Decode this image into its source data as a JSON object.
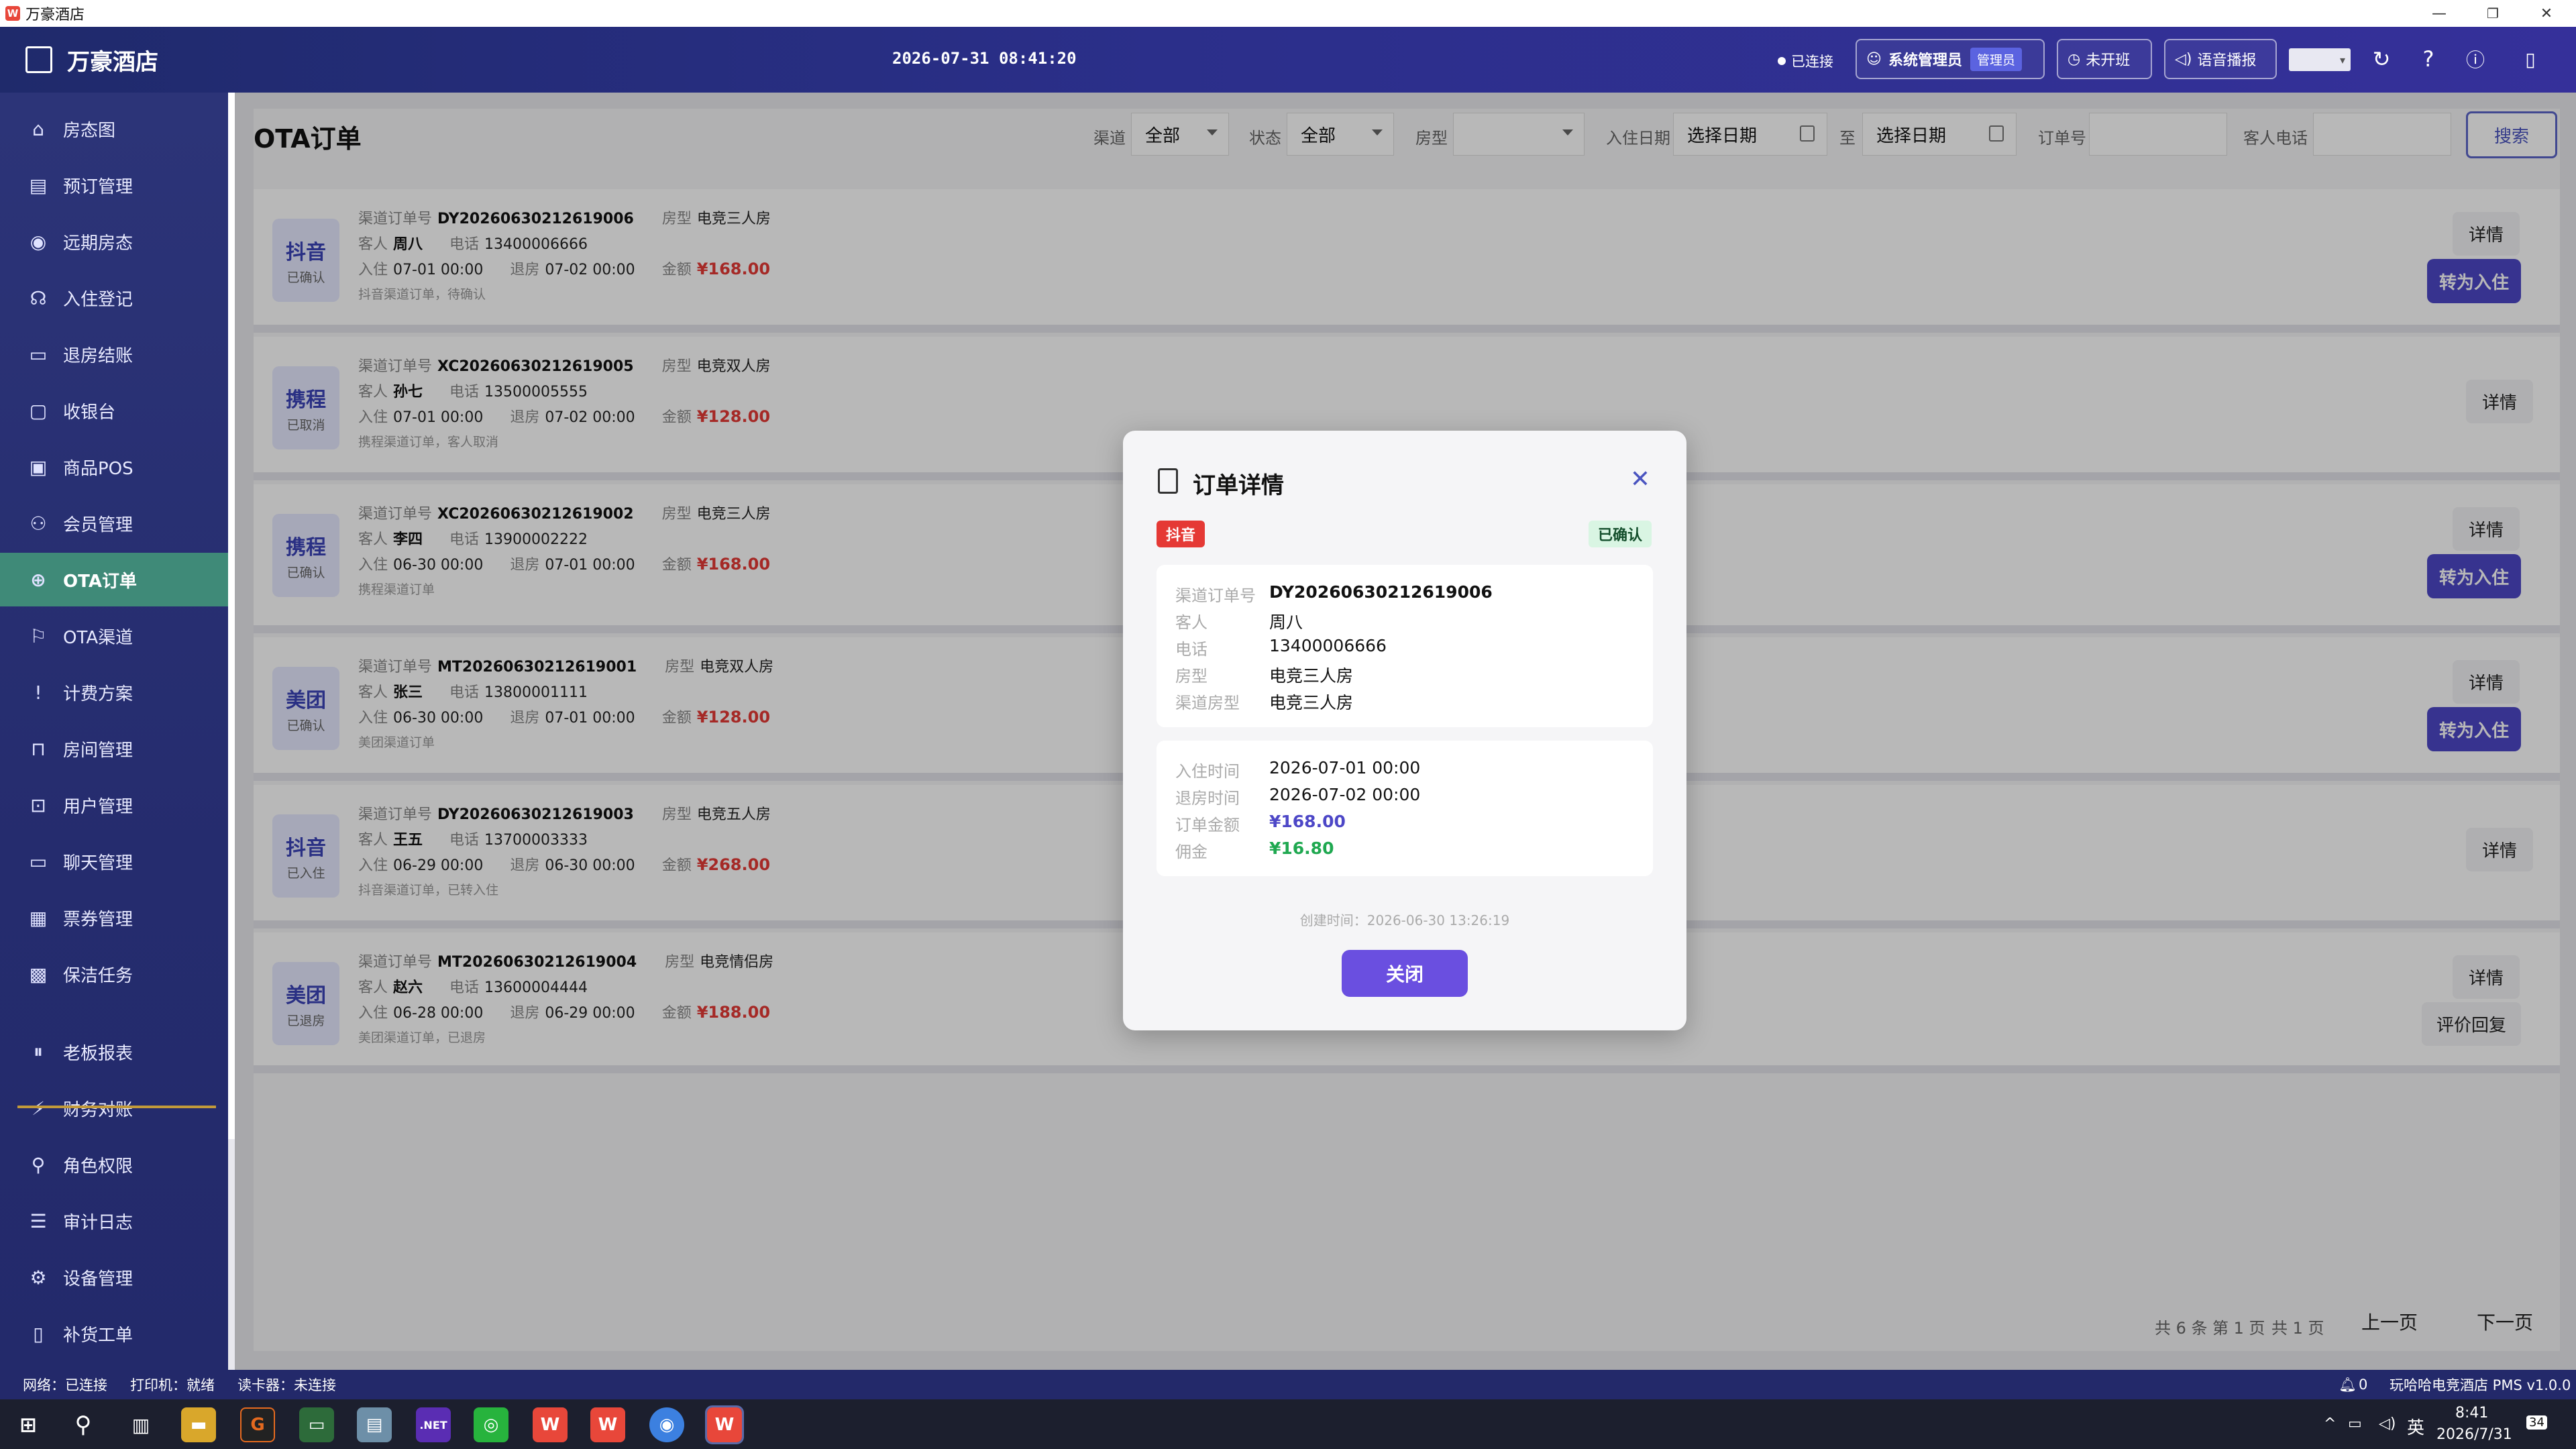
{
  "window": {
    "title": "万豪酒店",
    "icon_letter": "W",
    "minimize": "—",
    "restore": "❐",
    "close": "✕"
  },
  "header": {
    "brand": "万豪酒店",
    "clock": "2026-07-31 08:41:20",
    "connection": "已连接",
    "user": "系统管理员",
    "role": "管理员",
    "shift": "未开班",
    "voice": "语音播报",
    "icons": [
      "refresh-icon",
      "help-icon",
      "info-icon",
      "phone-icon"
    ]
  },
  "sidebar": {
    "items": [
      {
        "label": "房态图",
        "icon": "⌂"
      },
      {
        "label": "预订管理",
        "icon": "▤"
      },
      {
        "label": "远期房态",
        "icon": "◉"
      },
      {
        "label": "入住登记",
        "icon": "☊"
      },
      {
        "label": "退房结账",
        "icon": "▭"
      },
      {
        "label": "收银台",
        "icon": "▢"
      },
      {
        "label": "商品POS",
        "icon": "▣"
      },
      {
        "label": "会员管理",
        "icon": "⚇"
      },
      {
        "label": "OTA订单",
        "icon": "⊕"
      },
      {
        "label": "OTA渠道",
        "icon": "⚐"
      },
      {
        "label": "计费方案",
        "icon": "!"
      },
      {
        "label": "房间管理",
        "icon": "⊓"
      },
      {
        "label": "用户管理",
        "icon": "⊡"
      },
      {
        "label": "聊天管理",
        "icon": "▭"
      },
      {
        "label": "票券管理",
        "icon": "▦"
      },
      {
        "label": "保洁任务",
        "icon": "▩"
      },
      {
        "label": "老板报表",
        "icon": "⏸"
      },
      {
        "label": "财务对账",
        "icon": "⚡"
      },
      {
        "label": "角色权限",
        "icon": "⚲"
      },
      {
        "label": "审计日志",
        "icon": "☰"
      },
      {
        "label": "设备管理",
        "icon": "⚙"
      },
      {
        "label": "补货工单",
        "icon": "▯"
      }
    ],
    "active_index": 8
  },
  "filters": {
    "page_title": "OTA订单",
    "channel_label": "渠道",
    "channel_value": "全部",
    "status_label": "状态",
    "status_value": "全部",
    "room_type_label": "房型",
    "room_type_value": "",
    "checkin_label": "入住日期",
    "date_from": "选择日期",
    "to": "至",
    "date_to": "选择日期",
    "order_no_label": "订单号",
    "guest_phone_label": "客人电话",
    "search": "搜索"
  },
  "labels": {
    "channel_order": "渠道订单号",
    "room_type": "房型",
    "guest": "客人",
    "phone": "电话",
    "checkin": "入住",
    "checkout": "退房",
    "amount": "金额",
    "detail": "详情",
    "convert": "转为入住",
    "review": "评价回复"
  },
  "orders": [
    {
      "channel": "抖音",
      "status": "已确认",
      "order_no": "DY20260630212619006",
      "room_type": "电竞三人房",
      "guest": "周八",
      "phone": "13400006666",
      "checkin": "07-01 00:00",
      "checkout": "07-02 00:00",
      "amount": "¥168.00",
      "note": "抖音渠道订单，待确认"
    },
    {
      "channel": "携程",
      "status": "已取消",
      "order_no": "XC20260630212619005",
      "room_type": "电竞双人房",
      "guest": "孙七",
      "phone": "13500005555",
      "checkin": "07-01 00:00",
      "checkout": "07-02 00:00",
      "amount": "¥128.00",
      "note": "携程渠道订单，客人取消"
    },
    {
      "channel": "携程",
      "status": "已确认",
      "order_no": "XC20260630212619002",
      "room_type": "电竞三人房",
      "guest": "李四",
      "phone": "13900002222",
      "checkin": "06-30 00:00",
      "checkout": "07-01 00:00",
      "amount": "¥168.00",
      "note": "携程渠道订单"
    },
    {
      "channel": "美团",
      "status": "已确认",
      "order_no": "MT20260630212619001",
      "room_type": "电竞双人房",
      "guest": "张三",
      "phone": "13800001111",
      "checkin": "06-30 00:00",
      "checkout": "07-01 00:00",
      "amount": "¥128.00",
      "note": "美团渠道订单"
    },
    {
      "channel": "抖音",
      "status": "已入住",
      "order_no": "DY20260630212619003",
      "room_type": "电竞五人房",
      "guest": "王五",
      "phone": "13700003333",
      "checkin": "06-29 00:00",
      "checkout": "06-30 00:00",
      "amount": "¥268.00",
      "note": "抖音渠道订单，已转入住"
    },
    {
      "channel": "美团",
      "status": "已退房",
      "order_no": "MT20260630212619004",
      "room_type": "电竞情侣房",
      "guest": "赵六",
      "phone": "13600004444",
      "checkin": "06-28 00:00",
      "checkout": "06-29 00:00",
      "amount": "¥188.00",
      "note": "美团渠道订单，已退房"
    }
  ],
  "pager": {
    "total": "共 6 条",
    "page": "第 1 页",
    "pages": "共 1 页",
    "prev": "上一页",
    "next": "下一页"
  },
  "modal": {
    "title": "订单详情",
    "channel": "抖音",
    "status": "已确认",
    "rows1": [
      {
        "k": "渠道订单号",
        "v": "DY20260630212619006"
      },
      {
        "k": "客人",
        "v": "周八"
      },
      {
        "k": "电话",
        "v": "13400006666"
      },
      {
        "k": "房型",
        "v": "电竞三人房"
      },
      {
        "k": "渠道房型",
        "v": "电竞三人房"
      }
    ],
    "rows2": [
      {
        "k": "入住时间",
        "v": "2026-07-01 00:00"
      },
      {
        "k": "退房时间",
        "v": "2026-07-02 00:00"
      },
      {
        "k": "订单金额",
        "v": "¥168.00"
      },
      {
        "k": "佣金",
        "v": "¥16.80"
      }
    ],
    "created": "创建时间：2026-06-30 13:26:19",
    "close": "关闭"
  },
  "statusbar": {
    "network": "网络：已连接",
    "printer": "打印机：就绪",
    "card_reader": "读卡器：未连接",
    "bell_count": "0",
    "version": "玩哈哈电竞酒店 PMS v1.0.0"
  },
  "taskbar": {
    "time": "8:41",
    "date": "2026/7/31",
    "lang": "英",
    "notif": "34"
  },
  "colors": {
    "accent": "#4d47c7",
    "money": "#e53935",
    "active_nav": "#3f8a78",
    "header": "#2b2f8a"
  }
}
